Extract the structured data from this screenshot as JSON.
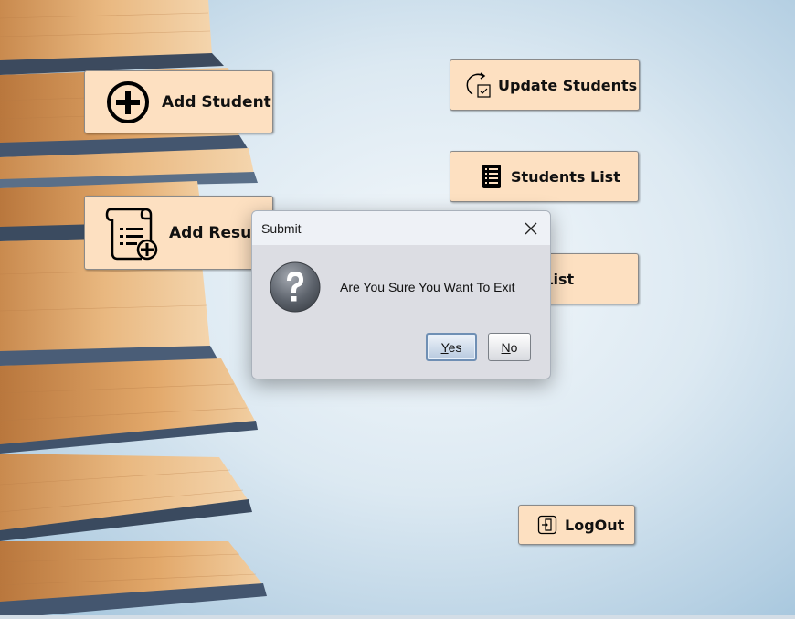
{
  "main": {
    "buttons": {
      "add_student": "Add Student",
      "add_result": "Add Result",
      "update_students": "Update Students",
      "students_list": "Students List",
      "results_list": "Results List",
      "logout": "LogOut"
    }
  },
  "dialog": {
    "title": "Submit",
    "message": "Are You Sure You Want To Exit",
    "yes_label": "Yes",
    "no_label": "No",
    "yes_mnemonic": "Y",
    "no_mnemonic": "N",
    "icon": "question-icon"
  },
  "colors": {
    "button_bg": "#fde0c1",
    "dialog_bg": "#dcdde3",
    "background": "#dce9f2"
  }
}
